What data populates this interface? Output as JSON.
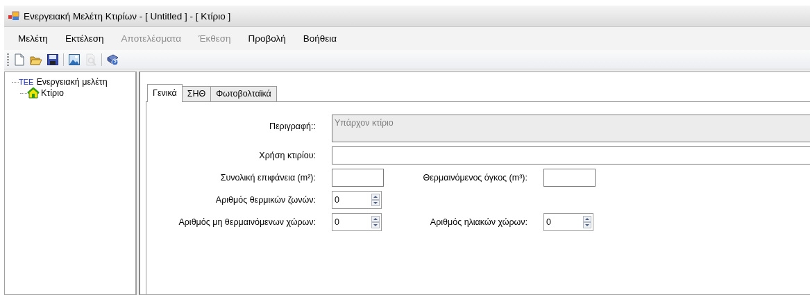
{
  "window": {
    "title": "Ενεργειακή Μελέτη Κτιρίων - [ Untitled ] - [ Κτίριο ]"
  },
  "menu": [
    {
      "label": "Μελέτη",
      "disabled": false
    },
    {
      "label": "Εκτέλεση",
      "disabled": false
    },
    {
      "label": "Αποτελέσματα",
      "disabled": true
    },
    {
      "label": "Έκθεση",
      "disabled": true
    },
    {
      "label": "Προβολή",
      "disabled": false
    },
    {
      "label": "Βοήθεια",
      "disabled": false
    }
  ],
  "toolbar": [
    {
      "kind": "new",
      "disabled": false
    },
    {
      "kind": "open",
      "disabled": false
    },
    {
      "kind": "save",
      "disabled": false
    },
    {
      "kind": "separator"
    },
    {
      "kind": "image",
      "disabled": false
    },
    {
      "kind": "preview",
      "disabled": true
    },
    {
      "kind": "separator"
    },
    {
      "kind": "help",
      "disabled": false
    }
  ],
  "tree": [
    {
      "label": "Ενεργειακή μελέτη",
      "icon_text": "ΤΕΕ",
      "kind": "logo",
      "children": [
        {
          "label": "Κτίριο",
          "kind": "house"
        }
      ]
    }
  ],
  "tabs": [
    {
      "label": "Γενικά",
      "selected": true
    },
    {
      "label": "ΣΗΘ",
      "selected": false
    },
    {
      "label": "Φωτοβολταϊκά",
      "selected": false
    }
  ],
  "form": {
    "description": {
      "label": "Περιγραφή::",
      "value": "Υπάρχον κτίριο",
      "disabled": true
    },
    "use": {
      "label": "Χρήση κτιρίου:"
    },
    "area": {
      "label": "Συνολική επιφάνεια (m²):"
    },
    "volume": {
      "label": "Θερμαινόμενος όγκος (m³):"
    },
    "zones": {
      "label": "Αριθμός θερμικών ζωνών:",
      "value": "0"
    },
    "unheated": {
      "label": "Αριθμός μη θερμαινόμενων χώρων:",
      "value": "0"
    },
    "sunspaces": {
      "label": "Αριθμός ηλιακών χώρων:",
      "value": "0"
    }
  }
}
